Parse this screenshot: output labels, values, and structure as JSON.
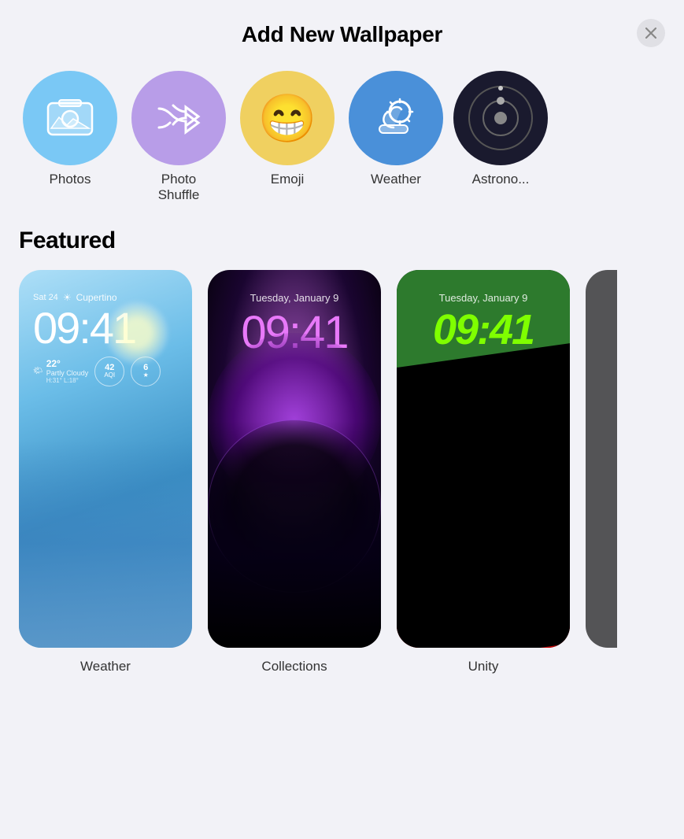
{
  "header": {
    "title": "Add New Wallpaper",
    "close_label": "×"
  },
  "categories": [
    {
      "id": "photos",
      "label": "Photos",
      "color": "photos"
    },
    {
      "id": "photo-shuffle",
      "label": "Photo\nShuffle",
      "color": "shuffle"
    },
    {
      "id": "emoji",
      "label": "Emoji",
      "color": "emoji"
    },
    {
      "id": "weather",
      "label": "Weather",
      "color": "weather"
    },
    {
      "id": "astronomy",
      "label": "Astronomy",
      "color": "astronomy"
    }
  ],
  "featured": {
    "title": "Featured",
    "wallpapers": [
      {
        "id": "weather",
        "label": "Weather",
        "meta": "Sat 24 ☀ Cupertino",
        "time": "09:41",
        "temp_icon": "🌤",
        "temp": "22°",
        "condition": "Partly Cloudy",
        "hi_lo": "H:31° L:18°",
        "badge1_label": "42",
        "badge1_sub": "AQI",
        "badge2_label": "6",
        "badge2_sub": "★"
      },
      {
        "id": "collections",
        "label": "Collections",
        "date": "Tuesday, January 9",
        "time": "09:41"
      },
      {
        "id": "unity",
        "label": "Unity",
        "date": "Tuesday, January 9",
        "time": "09:41"
      }
    ]
  }
}
